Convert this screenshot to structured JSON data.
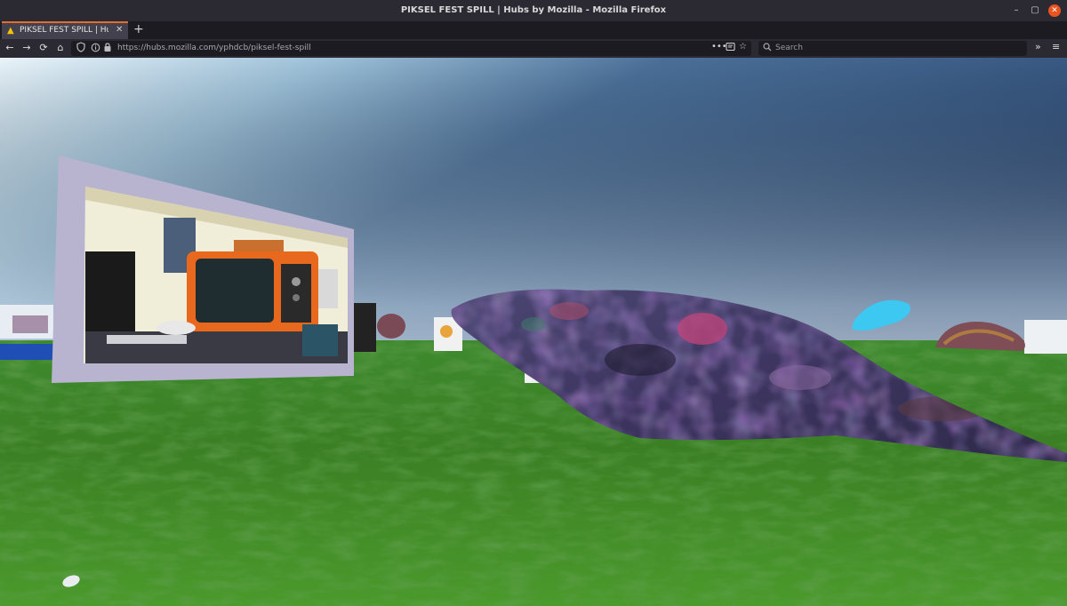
{
  "window": {
    "title": "PIKSEL FEST SPILL | Hubs by Mozilla - Mozilla Firefox",
    "minimize": "–",
    "maximize": "▢",
    "close": "✕"
  },
  "tab": {
    "label": "PIKSEL FEST SPILL | Hub",
    "favicon": "▲",
    "close": "✕",
    "new_tab": "+"
  },
  "nav": {
    "back": "←",
    "forward": "→",
    "reload": "⟳",
    "home": "⌂",
    "url": "https://hubs.mozilla.com/yphdcb/piksel-fest-spill",
    "page_actions": "•••",
    "bookmark": "☆",
    "search_placeholder": "Search",
    "overflow": "»",
    "menu": "≡"
  },
  "colors": {
    "accent": "#e66b2e",
    "sky_top": "#2f4e7a",
    "sky_bottom": "#cfe5f2",
    "grass": "#3d8a22",
    "frame": "#b8b3cf"
  }
}
